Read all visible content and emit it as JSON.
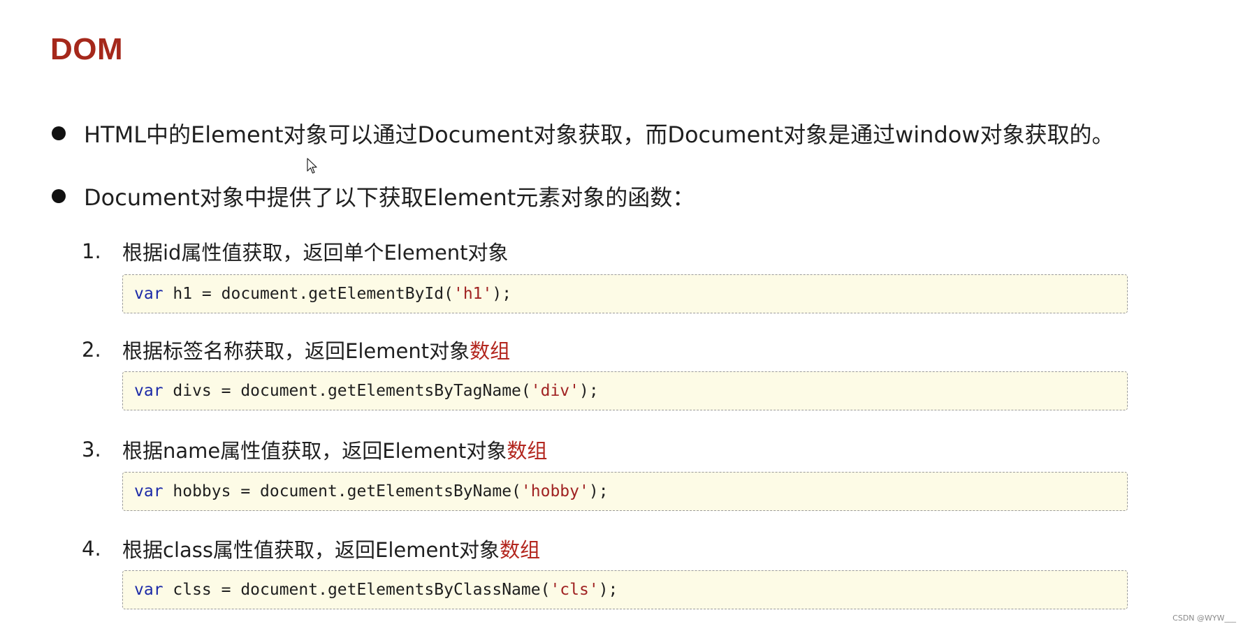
{
  "title": "DOM",
  "bullets": [
    "HTML中的Element对象可以通过Document对象获取，而Document对象是通过window对象获取的。",
    "Document对象中提供了以下获取Element元素对象的函数："
  ],
  "items": [
    {
      "number": "1.",
      "text": "根据id属性值获取，返回单个Element对象",
      "accent": "",
      "code": {
        "keyword": "var",
        "before": " h1 = document.getElementById(",
        "string": "'h1'",
        "after": ");"
      }
    },
    {
      "number": "2.",
      "text": "根据标签名称获取，返回Element对象",
      "accent": "数组",
      "code": {
        "keyword": "var",
        "before": " divs = document.getElementsByTagName(",
        "string": "'div'",
        "after": ");"
      }
    },
    {
      "number": "3.",
      "text": "根据name属性值获取，返回Element对象",
      "accent": "数组",
      "code": {
        "keyword": "var",
        "before": " hobbys = document.getElementsByName(",
        "string": "'hobby'",
        "after": ");"
      }
    },
    {
      "number": "4.",
      "text": "根据class属性值获取，返回Element对象",
      "accent": "数组",
      "code": {
        "keyword": "var",
        "before": " clss = document.getElementsByClassName(",
        "string": "'cls'",
        "after": ");"
      }
    }
  ],
  "watermark": "CSDN @WYW___",
  "colors": {
    "title": "#a5281b",
    "accent": "#b3261e",
    "keyword": "#1c2aa8",
    "string": "#a02222",
    "code_background": "#fdfbe6",
    "code_border": "#9a9a9a"
  }
}
